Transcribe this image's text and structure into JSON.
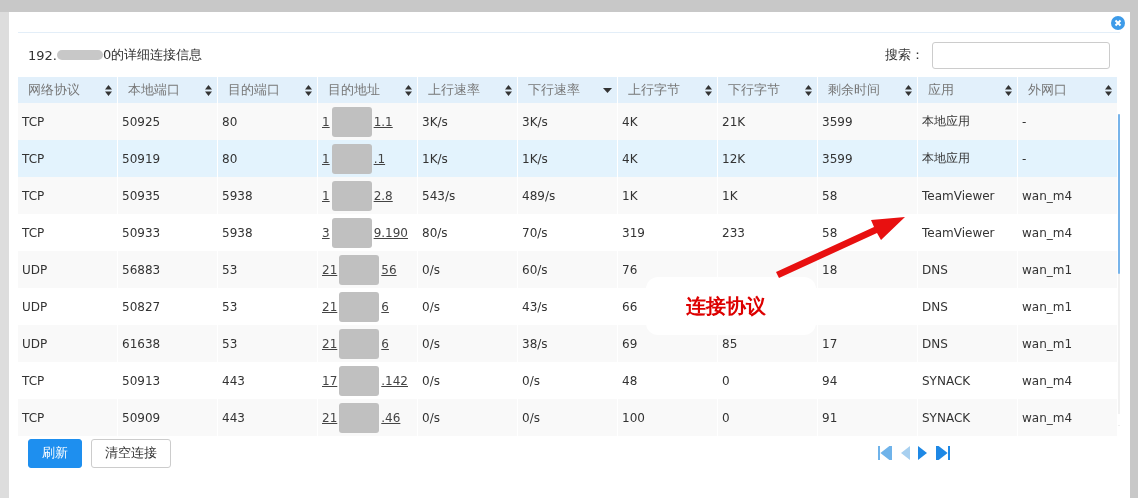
{
  "dialog": {
    "title_start": "192.",
    "title_end": "0的详细连接信息",
    "search": {
      "label": "搜索："
    }
  },
  "table": {
    "columns": [
      {
        "label": "网络协议",
        "kind": "sortable"
      },
      {
        "label": "本地端口",
        "kind": "sortable"
      },
      {
        "label": "目的端口",
        "kind": "sortable"
      },
      {
        "label": "目的地址",
        "kind": "sortable"
      },
      {
        "label": "上行速率",
        "kind": "sortable"
      },
      {
        "label": "下行速率",
        "kind": "descending"
      },
      {
        "label": "上行字节",
        "kind": "sortable"
      },
      {
        "label": "下行字节",
        "kind": "sortable"
      },
      {
        "label": "剩余时间",
        "kind": "sortable"
      },
      {
        "label": "应用",
        "kind": "sortable"
      },
      {
        "label": "外网口",
        "kind": "sortable"
      }
    ],
    "rows": [
      {
        "selected": false,
        "cells": [
          "TCP",
          "50925",
          "80",
          {
            "start": "1",
            "end": "1.1"
          },
          "3K/s",
          "3K/s",
          "4K",
          "21K",
          "3599",
          "本地应用",
          "-"
        ]
      },
      {
        "selected": true,
        "cells": [
          "TCP",
          "50919",
          "80",
          {
            "start": "1",
            "end": ".1"
          },
          "1K/s",
          "1K/s",
          "4K",
          "12K",
          "3599",
          "本地应用",
          "-"
        ]
      },
      {
        "selected": false,
        "cells": [
          "TCP",
          "50935",
          "5938",
          {
            "start": "1",
            "end": "2.8"
          },
          "543/s",
          "489/s",
          "1K",
          "1K",
          "58",
          "TeamViewer",
          "wan_m4"
        ]
      },
      {
        "selected": false,
        "cells": [
          "TCP",
          "50933",
          "5938",
          {
            "start": "3",
            "end": "9.190"
          },
          "80/s",
          "70/s",
          "319",
          "233",
          "58",
          "TeamViewer",
          "wan_m4"
        ]
      },
      {
        "selected": false,
        "cells": [
          "UDP",
          "56883",
          "53",
          {
            "start": "21",
            "end": "56"
          },
          "0/s",
          "60/s",
          "76",
          null,
          "18",
          "DNS",
          "wan_m1"
        ]
      },
      {
        "selected": false,
        "cells": [
          "UDP",
          "50827",
          "53",
          {
            "start": "21",
            "end": "6"
          },
          "0/s",
          "43/s",
          "66",
          null,
          null,
          "DNS",
          "wan_m1"
        ]
      },
      {
        "selected": false,
        "cells": [
          "UDP",
          "61638",
          "53",
          {
            "start": "21",
            "end": "6"
          },
          "0/s",
          "38/s",
          "69",
          "85",
          "17",
          "DNS",
          "wan_m1"
        ]
      },
      {
        "selected": false,
        "cells": [
          "TCP",
          "50913",
          "443",
          {
            "start": "17",
            "end": ".142"
          },
          "0/s",
          "0/s",
          "48",
          "0",
          "94",
          "SYNACK",
          "wan_m4"
        ]
      },
      {
        "selected": false,
        "cells": [
          "TCP",
          "50909",
          "443",
          {
            "start": "21",
            "end": ".46"
          },
          "0/s",
          "0/s",
          "100",
          "0",
          "91",
          "SYNACK",
          "wan_m4"
        ]
      }
    ]
  },
  "footer": {
    "buttons": [
      {
        "label": "刷新",
        "kind": "primary"
      },
      {
        "label": "清空连接",
        "kind": "default"
      }
    ]
  },
  "annotation": {
    "text": "连接协议"
  }
}
